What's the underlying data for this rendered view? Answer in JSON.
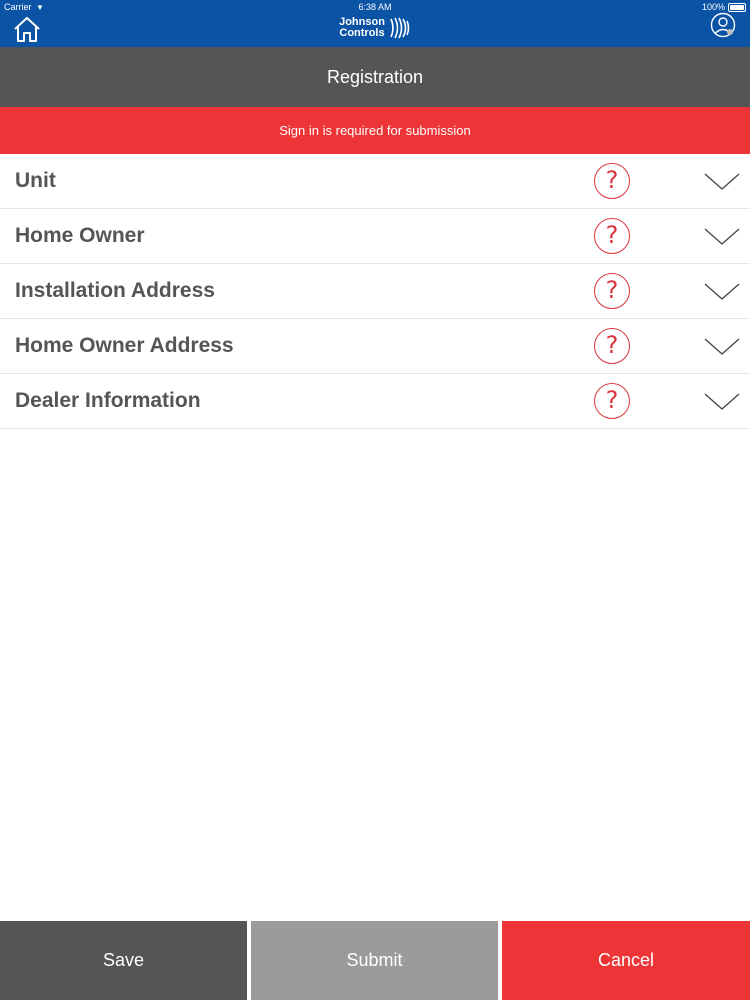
{
  "status_bar": {
    "carrier": "Carrier",
    "time": "6:38 AM",
    "battery": "100%"
  },
  "header": {
    "brand_line1": "Johnson",
    "brand_line2": "Controls",
    "home_icon": "home-icon",
    "account_icon": "user-account-icon"
  },
  "title": "Registration",
  "notice": "Sign in is required for submission",
  "sections": [
    {
      "label": "Unit"
    },
    {
      "label": "Home Owner"
    },
    {
      "label": "Installation Address"
    },
    {
      "label": "Home Owner Address"
    },
    {
      "label": "Dealer Information"
    }
  ],
  "section_help_glyph": "?",
  "actions": {
    "save": "Save",
    "submit": "Submit",
    "cancel": "Cancel"
  },
  "colors": {
    "header_blue": "#0a53a5",
    "title_gray": "#555555",
    "notice_red": "#ed3436",
    "help_red": "#d8343e",
    "submit_gray": "#9b9b9b"
  }
}
